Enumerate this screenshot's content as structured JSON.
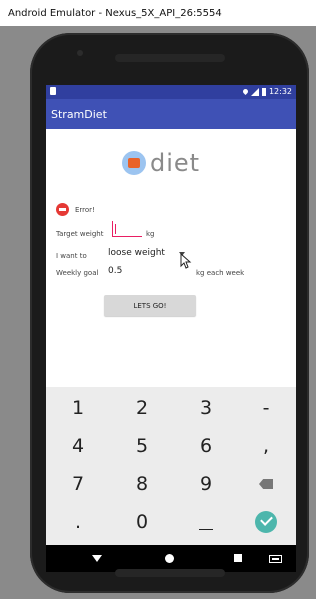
{
  "window": {
    "title": "Android Emulator - Nexus_5X_API_26:5554"
  },
  "status_bar": {
    "time": "12:32"
  },
  "app_bar": {
    "title": "StramDiet"
  },
  "logo": {
    "text": "diet"
  },
  "form": {
    "error_text": "Error!",
    "target_weight_label": "Target weight",
    "target_weight_value": "",
    "target_unit": "kg",
    "i_want_to_label": "I want to",
    "goal_type_selected": "loose weight",
    "weekly_goal_label": "Weekly goal",
    "weekly_goal_value": "0.5",
    "weekly_unit": "kg each week",
    "submit_label": "LETS GO!"
  },
  "keypad": {
    "keys": [
      [
        "1",
        "2",
        "3",
        "-"
      ],
      [
        "4",
        "5",
        "6",
        ","
      ],
      [
        "7",
        "8",
        "9",
        ""
      ],
      [
        ".",
        "0",
        "",
        ""
      ]
    ]
  },
  "colors": {
    "app_bar": "#3f51b5",
    "status_bar": "#303f9f",
    "accent": "#e91e63",
    "done": "#4db6ac"
  }
}
